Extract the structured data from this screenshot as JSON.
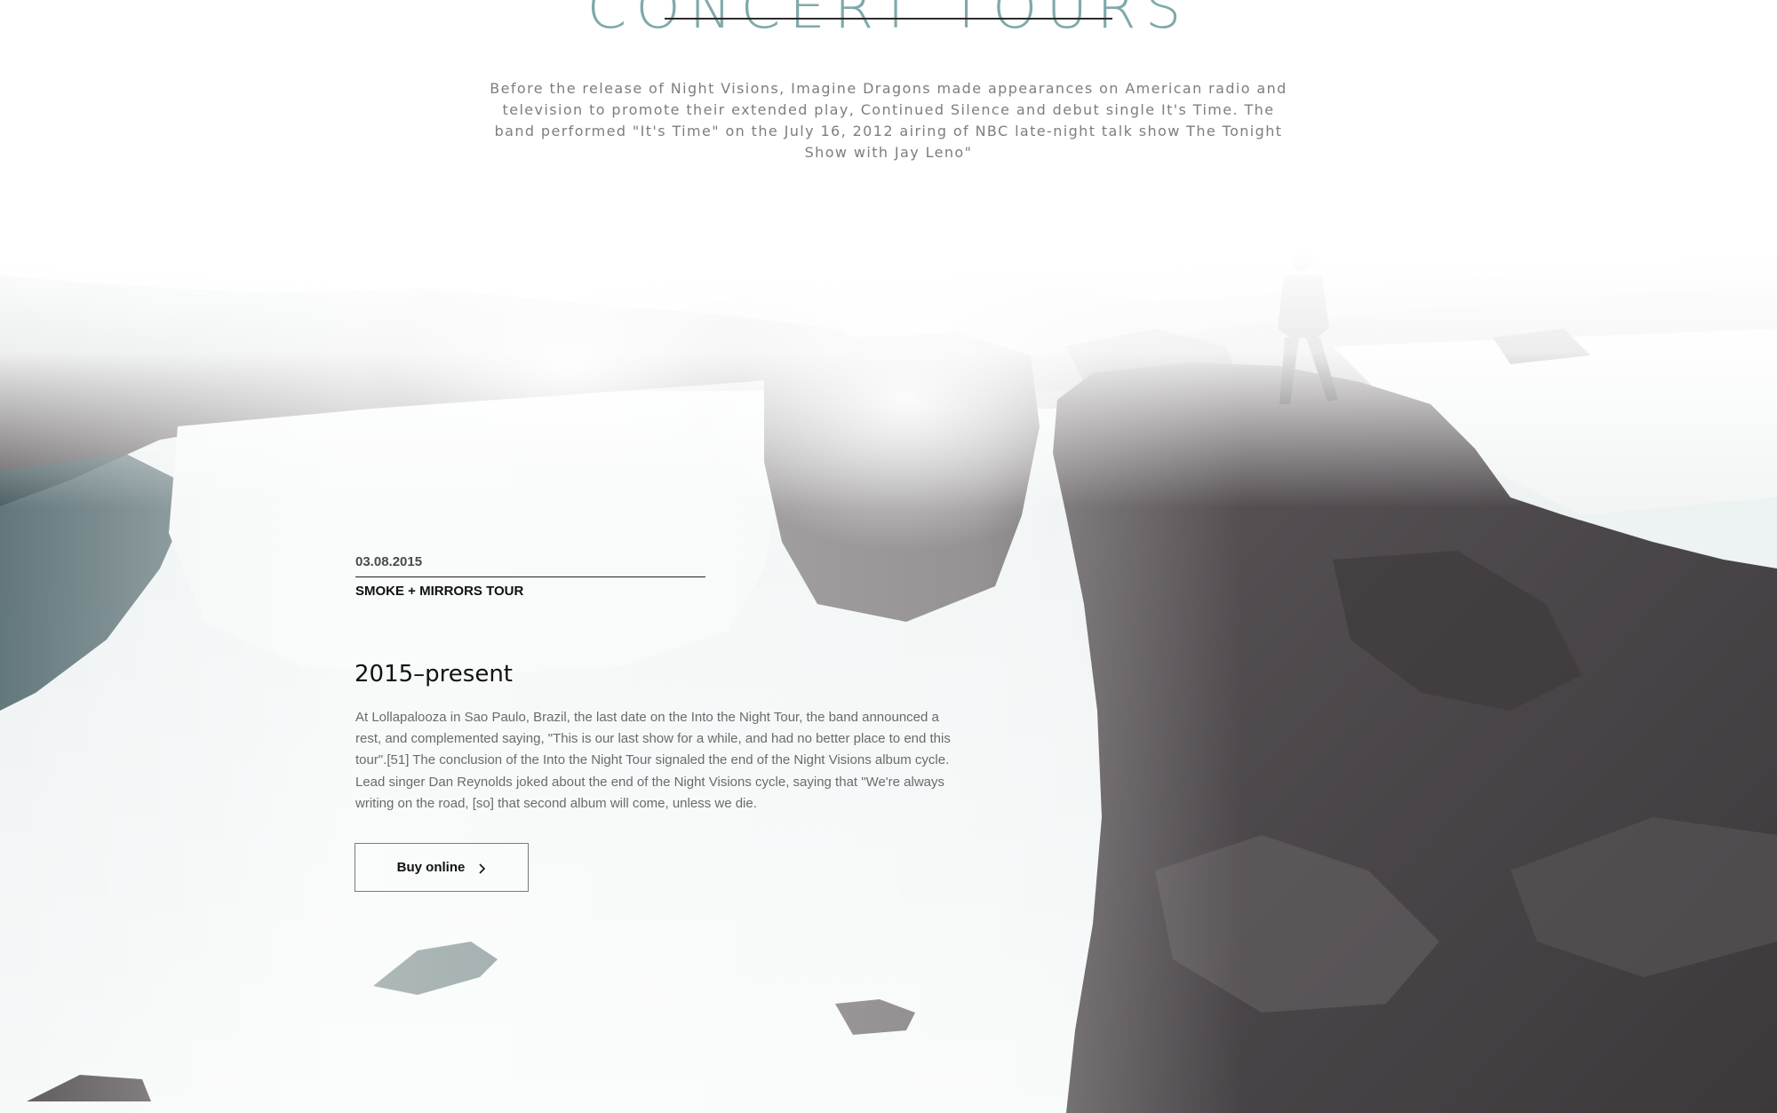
{
  "section": {
    "title": "CONCERT TOURS",
    "intro": "Before the release of Night Visions, Imagine Dragons made appearances on American radio and television to promote their extended play, Continued Silence and debut single It's Time. The band performed \"It's Time\" on the July 16, 2012 airing of NBC late-night talk show The Tonight Show with Jay Leno\""
  },
  "tour": {
    "date": "03.08.2015",
    "name": "SMOKE + MIRRORS TOUR",
    "period": "2015–present",
    "description": "At Lollapalooza in Sao Paulo, Brazil, the last date on the Into the Night Tour, the band announced a rest, and complemented saying, \"This is our last show for a while, and had no better place to end this tour\".[51] The conclusion of the Into the Night Tour signaled the end of the Night Visions album cycle. Lead singer Dan Reynolds joked about the end of the Night Visions cycle, saying that \"We're always writing on the road, [so] that second album will come, unless we die.",
    "buy_label": "Buy online",
    "buy_icon": "chevron-right-icon"
  },
  "colors": {
    "title": "#7fa9aa",
    "accent_teal": "#3f7f7f",
    "rock": "#4a4648",
    "mist": "#f2f4f4"
  }
}
